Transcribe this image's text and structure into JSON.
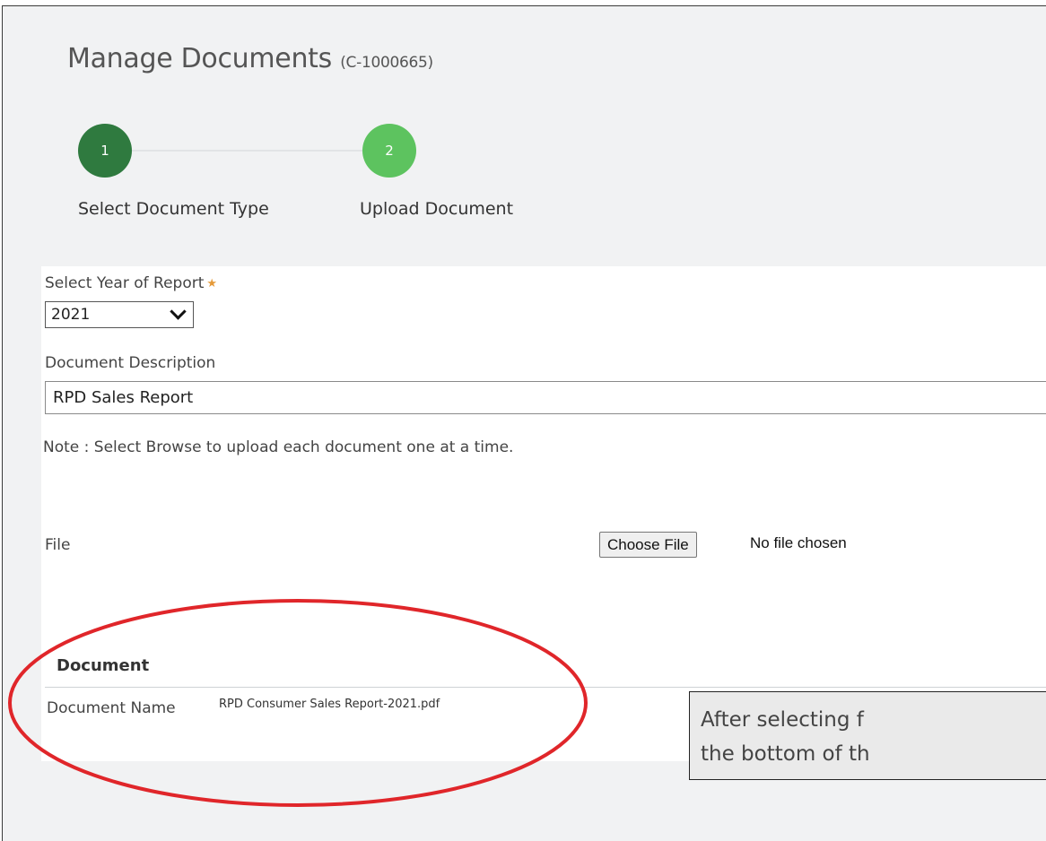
{
  "header": {
    "title": "Manage Documents",
    "record_code": "(C-1000665)"
  },
  "stepper": {
    "steps": [
      {
        "number": "1",
        "label": "Select Document Type",
        "color": "#2f7a3f"
      },
      {
        "number": "2",
        "label": "Upload Document",
        "color": "#5dc35f"
      }
    ]
  },
  "form": {
    "year_label": "Select Year of Report",
    "required_marker": "★",
    "year_value": "2021",
    "description_label": "Document Description",
    "description_value": "RPD Sales Report",
    "note": "Note : Select Browse to upload each document one at a time.",
    "file_label": "File",
    "choose_file_label": "Choose File",
    "no_file_text": "No file chosen"
  },
  "document": {
    "heading": "Document",
    "name_label": "Document Name",
    "name_value": "RPD Consumer Sales Report-2021.pdf"
  },
  "callout": {
    "line1": "After selecting f",
    "line2": "the bottom of th"
  },
  "colors": {
    "annotation": "#e0262a",
    "required": "#e59a3a"
  }
}
